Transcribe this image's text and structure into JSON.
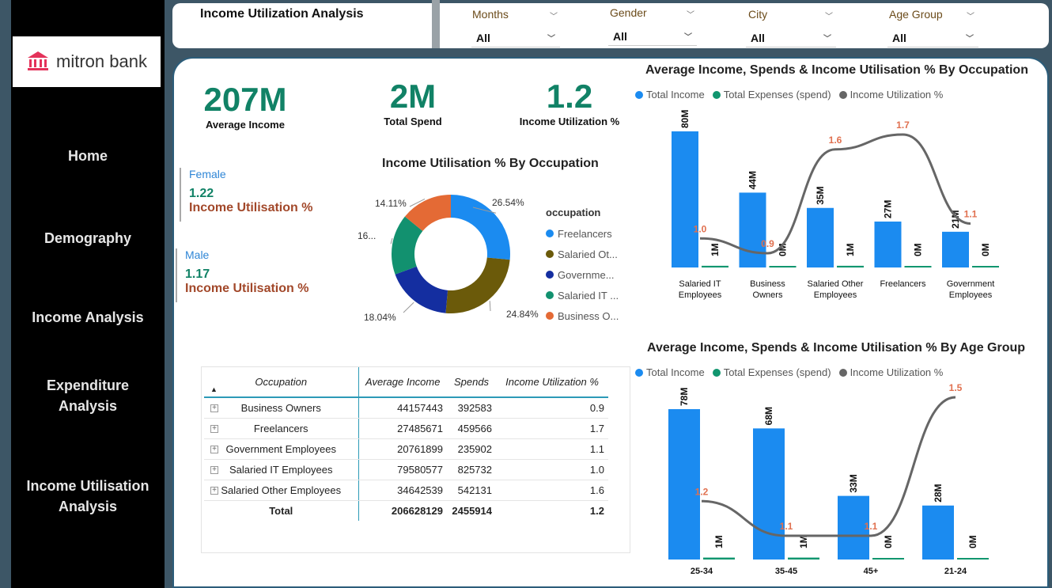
{
  "brand": {
    "name": "mitron bank",
    "color": "#e4325a"
  },
  "nav": [
    "Home",
    "Demography",
    "Income Analysis",
    "Expenditure Analysis",
    "Income Utilisation Analysis"
  ],
  "header": {
    "title": "Income Utilization Analysis",
    "filters": [
      {
        "label": "Months",
        "value": "All"
      },
      {
        "label": "Gender",
        "value": "All"
      },
      {
        "label": "City",
        "value": "All"
      },
      {
        "label": "Age Group",
        "value": "All"
      }
    ]
  },
  "kpis": [
    {
      "value": "207M",
      "label": "Average Income"
    },
    {
      "value": "2M",
      "label": "Total Spend"
    },
    {
      "value": "1.2",
      "label": "Income Utilization %"
    }
  ],
  "gender": [
    {
      "name": "Female",
      "value": "1.22",
      "label": "Income Utilisation %"
    },
    {
      "name": "Male",
      "value": "1.17",
      "label": "Income Utilisation %"
    }
  ],
  "donut": {
    "title": "Income Utilisation % By Occupation",
    "legend_title": "occupation",
    "legend": [
      "Freelancers",
      "Salaried Ot...",
      "Governme...",
      "Salaried IT ...",
      "Business O..."
    ],
    "labels": [
      "26.54%",
      "24.84%",
      "18.04%",
      "16...",
      "14.11%"
    ]
  },
  "occ_chart": {
    "title": "Average Income, Spends & Income Utilisation % By Occupation",
    "legend": [
      "Total Income",
      "Total Expenses (spend)",
      "Income Utilization %"
    ],
    "categories": [
      "Salaried IT Employees",
      "Business Owners",
      "Salaried Other Employees",
      "Freelancers",
      "Government Employees"
    ],
    "income_labels": [
      "80M",
      "44M",
      "35M",
      "27M",
      "21M"
    ],
    "spend_labels": [
      "1M",
      "0M",
      "1M",
      "0M",
      "0M"
    ],
    "util_labels": [
      "1.0",
      "0.9",
      "1.6",
      "1.7",
      "1.1"
    ]
  },
  "age_chart": {
    "title": "Average Income, Spends & Income Utilisation % By Age Group",
    "legend": [
      "Total Income",
      "Total Expenses (spend)",
      "Income Utilization %"
    ],
    "categories": [
      "25-34",
      "35-45",
      "45+",
      "21-24"
    ],
    "income_labels": [
      "78M",
      "68M",
      "33M",
      "28M"
    ],
    "spend_labels": [
      "1M",
      "1M",
      "0M",
      "0M"
    ],
    "util_labels": [
      "1.2",
      "1.1",
      "1.1",
      "1.5"
    ]
  },
  "table": {
    "headers": [
      "Occupation",
      "Average Income",
      "Spends",
      "Income Utilization %"
    ],
    "rows": [
      {
        "occ": "Business Owners",
        "income": "44157443",
        "spends": "392583",
        "util": "0.9"
      },
      {
        "occ": "Freelancers",
        "income": "27485671",
        "spends": "459566",
        "util": "1.7"
      },
      {
        "occ": "Government Employees",
        "income": "20761899",
        "spends": "235902",
        "util": "1.1"
      },
      {
        "occ": "Salaried IT Employees",
        "income": "79580577",
        "spends": "825732",
        "util": "1.0"
      },
      {
        "occ": "Salaried Other Employees",
        "income": "34642539",
        "spends": "542131",
        "util": "1.6"
      }
    ],
    "total": {
      "occ": "Total",
      "income": "206628129",
      "spends": "2455914",
      "util": "1.2"
    }
  },
  "colors": {
    "income": "#1b8bf0",
    "expense": "#11966f",
    "util_line": "#666666",
    "util_label": "#e0704f",
    "donut": [
      "#1b8bf0",
      "#6b5a0a",
      "#142ea0",
      "#12916f",
      "#e46a35"
    ]
  },
  "chart_data": [
    {
      "type": "pie",
      "title": "Income Utilisation % By Occupation",
      "categories": [
        "Freelancers",
        "Salaried Other Employees",
        "Government Employees",
        "Salaried IT Employees",
        "Business Owners"
      ],
      "values": [
        26.54,
        24.84,
        18.04,
        16.47,
        14.11
      ]
    },
    {
      "type": "bar",
      "title": "Average Income, Spends & Income Utilisation % By Occupation",
      "categories": [
        "Salaried IT Employees",
        "Business Owners",
        "Salaried Other Employees",
        "Freelancers",
        "Government Employees"
      ],
      "series": [
        {
          "name": "Total Income",
          "values": [
            80,
            44,
            35,
            27,
            21
          ]
        },
        {
          "name": "Total Expenses (spend)",
          "values": [
            1,
            0,
            1,
            0,
            0
          ]
        },
        {
          "name": "Income Utilization %",
          "values": [
            1.0,
            0.9,
            1.6,
            1.7,
            1.1
          ]
        }
      ]
    },
    {
      "type": "bar",
      "title": "Average Income, Spends & Income Utilisation % By Age Group",
      "categories": [
        "25-34",
        "35-45",
        "45+",
        "21-24"
      ],
      "series": [
        {
          "name": "Total Income",
          "values": [
            78,
            68,
            33,
            28
          ]
        },
        {
          "name": "Total Expenses (spend)",
          "values": [
            1,
            1,
            0,
            0
          ]
        },
        {
          "name": "Income Utilization %",
          "values": [
            1.2,
            1.1,
            1.1,
            1.5
          ]
        }
      ]
    }
  ]
}
